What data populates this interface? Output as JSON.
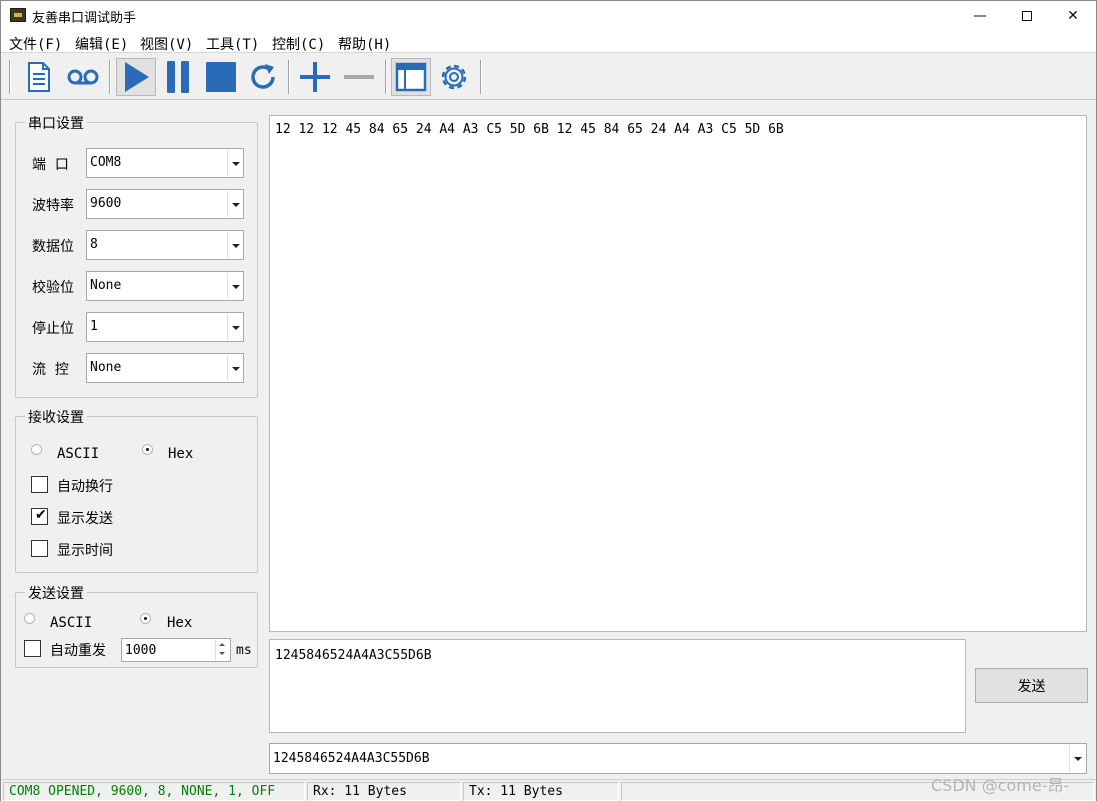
{
  "window": {
    "title": "友善串口调试助手",
    "minimize": "—",
    "close": "✕"
  },
  "menu": [
    "文件(F)",
    "编辑(E)",
    "视图(V)",
    "工具(T)",
    "控制(C)",
    "帮助(H)"
  ],
  "toolbar": {
    "icons": [
      "new-file-icon",
      "record-icon",
      "play-icon",
      "pause-icon",
      "stop-icon",
      "refresh-icon",
      "plus-icon",
      "minus-icon",
      "window-icon",
      "settings-gear-icon"
    ],
    "accent": "#2a6bb8"
  },
  "serial": {
    "title": "串口设置",
    "fields": [
      {
        "label": "端  口",
        "value": "COM8"
      },
      {
        "label": "波特率",
        "value": "9600"
      },
      {
        "label": "数据位",
        "value": "8"
      },
      {
        "label": "校验位",
        "value": "None"
      },
      {
        "label": "停止位",
        "value": "1"
      },
      {
        "label": "流  控",
        "value": "None"
      }
    ]
  },
  "receive": {
    "title": "接收设置",
    "ascii": "ASCII",
    "hex": "Hex",
    "selected": "Hex",
    "options": [
      {
        "label": "自动换行",
        "checked": false
      },
      {
        "label": "显示发送",
        "checked": true
      },
      {
        "label": "显示时间",
        "checked": false
      }
    ],
    "content": "12 12 12 45 84 65 24 A4 A3 C5 5D 6B 12 45 84 65 24 A4 A3 C5 5D 6B"
  },
  "send": {
    "title": "发送设置",
    "ascii": "ASCII",
    "hex": "Hex",
    "selected": "Hex",
    "auto_resend": {
      "label": "自动重发",
      "checked": false
    },
    "interval": "1000",
    "unit": "ms",
    "content": "1245846524A4A3C55D6B",
    "button": "发送",
    "history": "1245846524A4A3C55D6B"
  },
  "status": {
    "port": "COM8 OPENED, 9600, 8, NONE, 1, OFF",
    "port_color": "#008000",
    "rx": "Rx: 11 Bytes",
    "tx": "Tx: 11 Bytes"
  },
  "watermark": "CSDN @come-昂-"
}
